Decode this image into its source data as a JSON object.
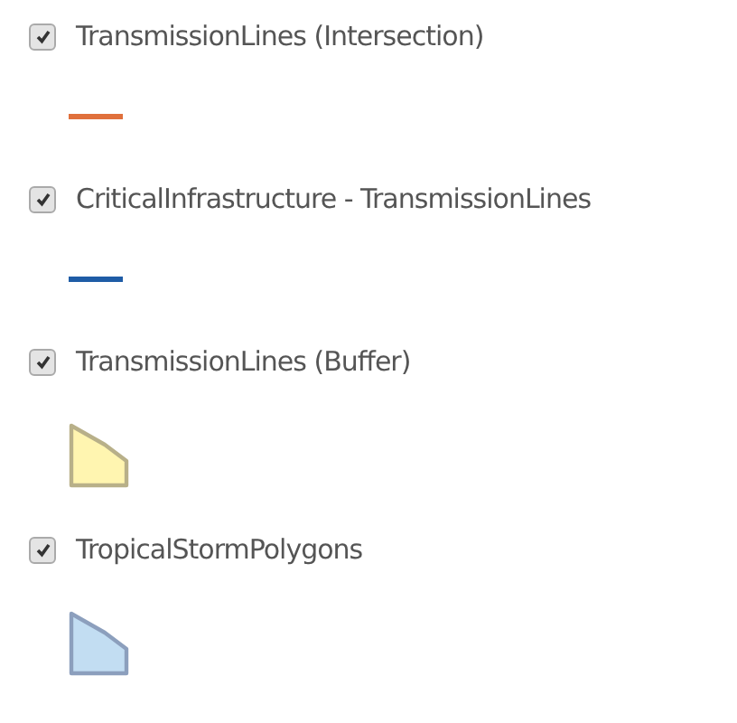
{
  "layers": [
    {
      "label": "TransmissionLines (Intersection)",
      "checked": true,
      "symbol": {
        "kind": "line",
        "color": "#e0703c"
      }
    },
    {
      "label": "CriticalInfrastructure - TransmissionLines",
      "checked": true,
      "symbol": {
        "kind": "line",
        "color": "#1f5ca6"
      }
    },
    {
      "label": "TransmissionLines (Buffer)",
      "checked": true,
      "symbol": {
        "kind": "polygon",
        "color": "#fff5b0"
      }
    },
    {
      "label": "TropicalStormPolygons",
      "checked": true,
      "symbol": {
        "kind": "polygon",
        "color": "#c2ddf2"
      }
    }
  ]
}
